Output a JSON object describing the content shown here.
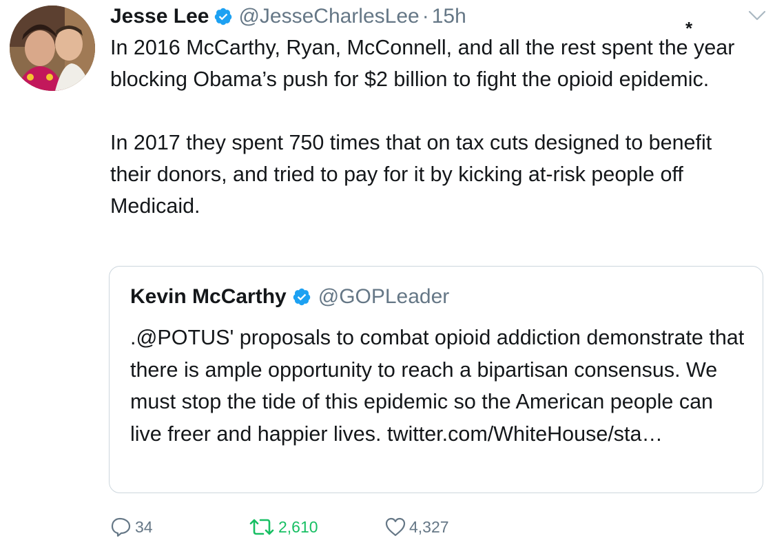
{
  "tweet": {
    "author_name": "Jesse Lee",
    "author_handle": "@JesseCharlesLee",
    "separator": "·",
    "timestamp": "15h",
    "asterisk": "*",
    "paragraph_1": "In 2016 McCarthy, Ryan, McConnell, and all the rest spent the year blocking Obama’s push for $2 billion to fight the opioid epidemic.",
    "paragraph_2": "In 2017 they spent 750 times that on tax cuts designed to benefit their donors, and tried to pay for it by kicking at-risk people off Medicaid."
  },
  "quoted_tweet": {
    "author_name": "Kevin McCarthy",
    "author_handle": "@GOPLeader",
    "text": ".@POTUS' proposals to combat opioid addiction demonstrate that there is ample opportunity to reach a bipartisan consensus. We must stop the tide of this epidemic so the American people can live freer and happier lives. twitter.com/WhiteHouse/sta…"
  },
  "actions": {
    "reply_count": "34",
    "retweet_count": "2,610",
    "like_count": "4,327"
  },
  "icons": {
    "verified": "verified-badge-icon",
    "menu": "chevron-down-icon",
    "reply": "reply-bubble-icon",
    "retweet": "retweet-icon",
    "like": "heart-icon"
  },
  "colors": {
    "verified_blue": "#1da1f2",
    "retweet_green": "#17bf63",
    "secondary_gray": "#657786",
    "border": "#ccd6dd"
  }
}
